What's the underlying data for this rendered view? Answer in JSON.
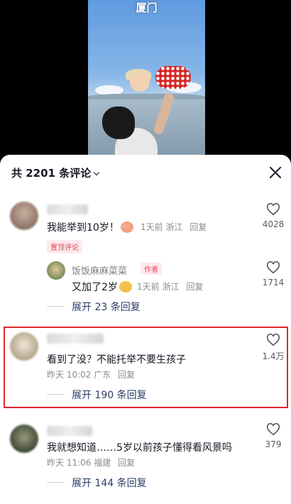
{
  "video": {
    "title": "厦门"
  },
  "sheet": {
    "title": "共 2201 条评论",
    "close_icon": "close-icon"
  },
  "comments": [
    {
      "text": "我能举到10岁！",
      "time": "1天前",
      "location": "浙江",
      "reply": "回复",
      "likes": "4028",
      "pin_label": "置顶评论",
      "sub_reply": {
        "name": "饭饭麻麻菜菜",
        "author_tag": "作者",
        "text": "又加了2岁",
        "time": "1天前",
        "location": "浙江",
        "reply": "回复",
        "likes": "1714"
      },
      "expand": "展开 23 条回复"
    },
    {
      "text": "看到了没？不能托举不要生孩子",
      "time": "昨天 10:02",
      "location": "广东",
      "reply": "回复",
      "likes": "1.4万",
      "expand": "展开 190 条回复"
    },
    {
      "text": "我就想知道……5岁以前孩子懂得看风景吗",
      "time": "昨天 11:06",
      "location": "福建",
      "reply": "回复",
      "likes": "379",
      "expand": "展开 144 条回复"
    }
  ],
  "colors": {
    "highlight": "#e0262e",
    "expand_text": "#2a3d66",
    "tag": "#e2455a"
  }
}
